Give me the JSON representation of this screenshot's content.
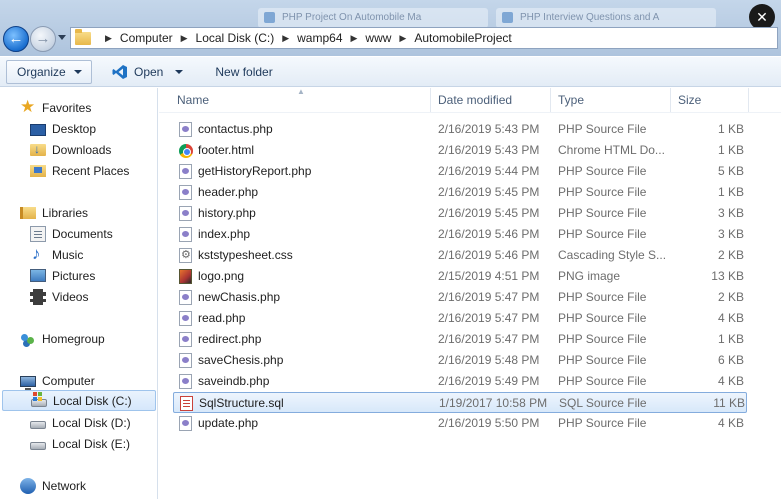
{
  "background_tabs": [
    {
      "label": "PHP Project On Automobile Ma"
    },
    {
      "label": "PHP Interview Questions and A"
    }
  ],
  "address": {
    "crumbs": [
      "Computer",
      "Local Disk (C:)",
      "wamp64",
      "www",
      "AutomobileProject"
    ]
  },
  "toolbar": {
    "organize_label": "Organize",
    "open_label": "Open",
    "new_folder_label": "New folder"
  },
  "sidebar": {
    "favorites": "Favorites",
    "desktop": "Desktop",
    "downloads": "Downloads",
    "recent_places": "Recent Places",
    "libraries": "Libraries",
    "documents": "Documents",
    "music": "Music",
    "pictures": "Pictures",
    "videos": "Videos",
    "homegroup": "Homegroup",
    "computer": "Computer",
    "drive_c": "Local Disk (C:)",
    "drive_d": "Local Disk (D:)",
    "drive_e": "Local Disk (E:)",
    "network": "Network"
  },
  "columns": {
    "name": "Name",
    "date": "Date modified",
    "type": "Type",
    "size": "Size"
  },
  "files": [
    {
      "name": "contactus.php",
      "date": "2/16/2019 5:43 PM",
      "type": "PHP Source File",
      "size": "1 KB",
      "icon": "php-file-icon"
    },
    {
      "name": "footer.html",
      "date": "2/16/2019 5:43 PM",
      "type": "Chrome HTML Do...",
      "size": "1 KB",
      "icon": "chrome-icon"
    },
    {
      "name": "getHistoryReport.php",
      "date": "2/16/2019 5:44 PM",
      "type": "PHP Source File",
      "size": "5 KB",
      "icon": "php-file-icon"
    },
    {
      "name": "header.php",
      "date": "2/16/2019 5:45 PM",
      "type": "PHP Source File",
      "size": "1 KB",
      "icon": "php-file-icon"
    },
    {
      "name": "history.php",
      "date": "2/16/2019 5:45 PM",
      "type": "PHP Source File",
      "size": "3 KB",
      "icon": "php-file-icon"
    },
    {
      "name": "index.php",
      "date": "2/16/2019 5:46 PM",
      "type": "PHP Source File",
      "size": "3 KB",
      "icon": "php-file-icon"
    },
    {
      "name": "kststypesheet.css",
      "date": "2/16/2019 5:46 PM",
      "type": "Cascading Style S...",
      "size": "2 KB",
      "icon": "css-file-icon"
    },
    {
      "name": "logo.png",
      "date": "2/15/2019 4:51 PM",
      "type": "PNG image",
      "size": "13 KB",
      "icon": "png-file-icon"
    },
    {
      "name": "newChasis.php",
      "date": "2/16/2019 5:47 PM",
      "type": "PHP Source File",
      "size": "2 KB",
      "icon": "php-file-icon"
    },
    {
      "name": "read.php",
      "date": "2/16/2019 5:47 PM",
      "type": "PHP Source File",
      "size": "4 KB",
      "icon": "php-file-icon"
    },
    {
      "name": "redirect.php",
      "date": "2/16/2019 5:47 PM",
      "type": "PHP Source File",
      "size": "1 KB",
      "icon": "php-file-icon"
    },
    {
      "name": "saveChesis.php",
      "date": "2/16/2019 5:48 PM",
      "type": "PHP Source File",
      "size": "6 KB",
      "icon": "php-file-icon"
    },
    {
      "name": "saveindb.php",
      "date": "2/16/2019 5:49 PM",
      "type": "PHP Source File",
      "size": "4 KB",
      "icon": "php-file-icon"
    },
    {
      "name": "SqlStructure.sql",
      "date": "1/19/2017 10:58 PM",
      "type": "SQL Source File",
      "size": "11 KB",
      "icon": "sql-file-icon"
    },
    {
      "name": "update.php",
      "date": "2/16/2019 5:50 PM",
      "type": "PHP Source File",
      "size": "4 KB",
      "icon": "php-file-icon"
    }
  ],
  "colors": {
    "selection_fill": "#d7e8fa",
    "selection_border": "#84acdd",
    "toolbar_text": "#1e395b"
  }
}
